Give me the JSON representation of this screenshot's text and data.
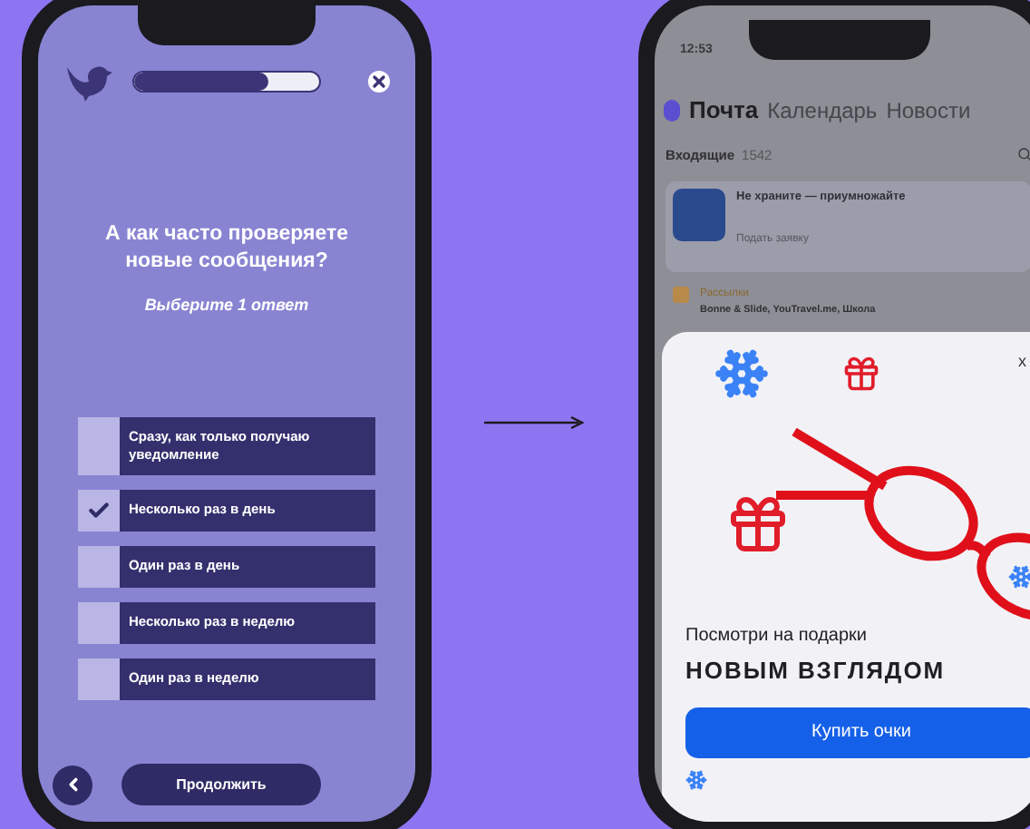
{
  "left_screen": {
    "progress": {
      "level": 0.73
    },
    "question": "А как часто проверяете новые сообщения?",
    "hint": "Выберите 1 ответ",
    "options": [
      {
        "label": "Сразу, как только получаю уведомление",
        "checked": false
      },
      {
        "label": "Несколько раз в день",
        "checked": true
      },
      {
        "label": "Один раз в день",
        "checked": false
      },
      {
        "label": "Несколько раз в неделю",
        "checked": false
      },
      {
        "label": "Один раз в неделю",
        "checked": false
      }
    ],
    "continue_button": "Продолжить"
  },
  "right_screen": {
    "status_time": "12:53",
    "tabs": [
      {
        "label": "Почта",
        "selected": true
      },
      {
        "label": "Календарь",
        "selected": false
      },
      {
        "label": "Новости",
        "selected": false
      }
    ],
    "inbox": {
      "label": "Входящие",
      "count": "1542"
    },
    "promo_card": {
      "title": "Не храните — приумножайте",
      "action": "Подать заявку"
    },
    "newsletter": {
      "title": "Рассылки",
      "senders": "Bonne & Slide, YouTravel.me, Школа"
    },
    "popup": {
      "close": "x",
      "line1": "Посмотри на подарки",
      "line2": "НОВЫМ ВЗГЛЯДОМ",
      "button": "Купить очки"
    }
  }
}
